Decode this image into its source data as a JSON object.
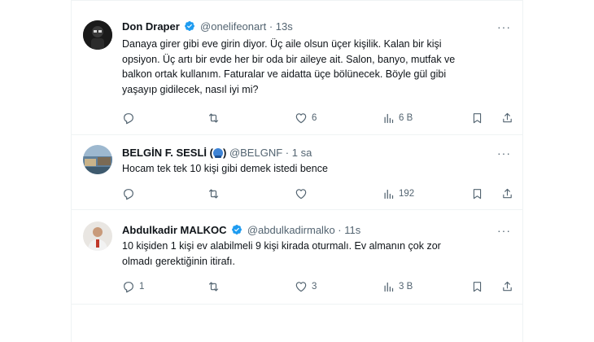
{
  "tweets": [
    {
      "name": "Don Draper",
      "handle": "@onelifeonart",
      "sep": "·",
      "time": "13s",
      "lines": [
        "Danaya girer gibi eve girin diyor. Üç aile olsun üçer kişilik. Kalan bir kişi",
        "opsiyon. Üç artı bir evde her bir oda bir aileye ait. Salon, banyo, mutfak ve",
        "balkon ortak kullanım. Faturalar ve aidatta üçe bölünecek. Böyle gül gibi",
        "yaşayıp gidilecek, nasıl iyi mi?"
      ],
      "replies": "",
      "retweets": "",
      "likes": "6",
      "views": "6 B"
    },
    {
      "name": "BELGİN F. SESLİ (",
      "name_end": ")",
      "handle": "@BELGNF",
      "sep": "·",
      "time": "1 sa",
      "lines": [
        "Hocam tek tek 10 kişi gibi demek istedi bence"
      ],
      "replies": "",
      "retweets": "",
      "likes": "",
      "views": "192"
    },
    {
      "name": "Abdulkadir MALKOC",
      "handle": "@abdulkadirmalko",
      "sep": "·",
      "time": "11s",
      "lines": [
        "10 kişiden 1 kişi ev alabilmeli 9 kişi kirada oturmalı. Ev almanın çok zor",
        "olmadı gerektiğinin itirafı."
      ],
      "replies": "1",
      "retweets": "",
      "likes": "3",
      "views": "3 B"
    }
  ],
  "icons": {
    "reply": "reply-icon",
    "retweet": "retweet-icon",
    "like": "heart-icon",
    "views": "views-chart-icon",
    "bookmark": "bookmark-icon",
    "share": "share-icon",
    "verified": "verified-badge-icon",
    "more": "more-icon"
  },
  "colors": {
    "verified": "#1d9bf0",
    "secondary_text": "#536471",
    "primary_text": "#0f1419",
    "divider": "#eff3f4"
  }
}
